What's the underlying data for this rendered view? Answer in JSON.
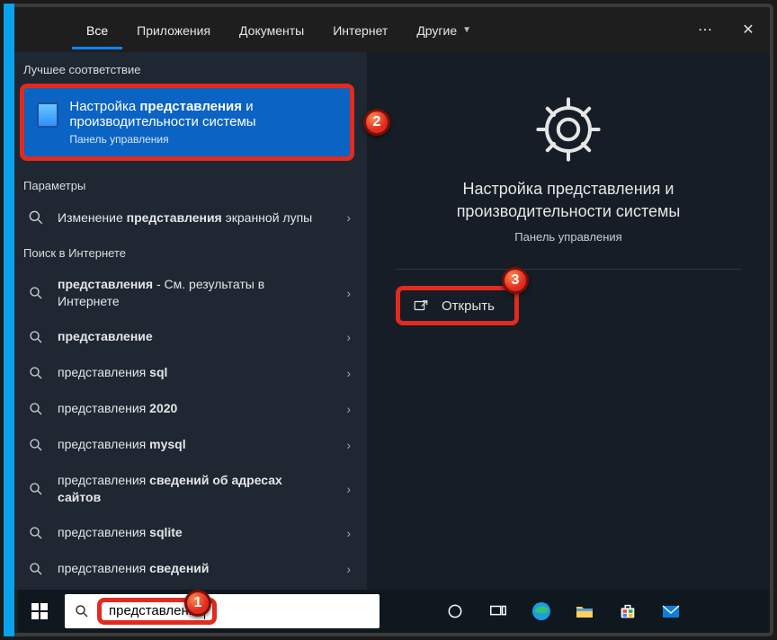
{
  "tabs": {
    "all": "Все",
    "apps": "Приложения",
    "docs": "Документы",
    "web": "Интернет",
    "other": "Другие"
  },
  "sections": {
    "best": "Лучшее соответствие",
    "params": "Параметры",
    "websearch": "Поиск в Интернете"
  },
  "bestMatch": {
    "line1_pre": "Настройка ",
    "line1_bold": "представления",
    "line1_post": " и производительности системы",
    "sub": "Панель управления"
  },
  "results": {
    "r1_pre": "Изменение ",
    "r1_bold": "представления",
    "r1_post": " экранной лупы",
    "r2_bold": "представления",
    "r2_post": " - См. результаты в Интернете",
    "r3": "представление",
    "r4_pre": "представления ",
    "r4_bold": "sql",
    "r5_pre": "представления ",
    "r5_bold": "2020",
    "r6_pre": "представления ",
    "r6_bold": "mysql",
    "r7_pre": "представления ",
    "r7_bold": "сведений об адресах сайтов",
    "r8_pre": "представления ",
    "r8_bold": "sqlite",
    "r9_pre": "представления ",
    "r9_bold": "сведений"
  },
  "detail": {
    "title": "Настройка представления и производительности системы",
    "sub": "Панель управления",
    "open": "Открыть"
  },
  "search": {
    "value": "представления"
  },
  "badges": {
    "one": "1",
    "two": "2",
    "three": "3"
  }
}
